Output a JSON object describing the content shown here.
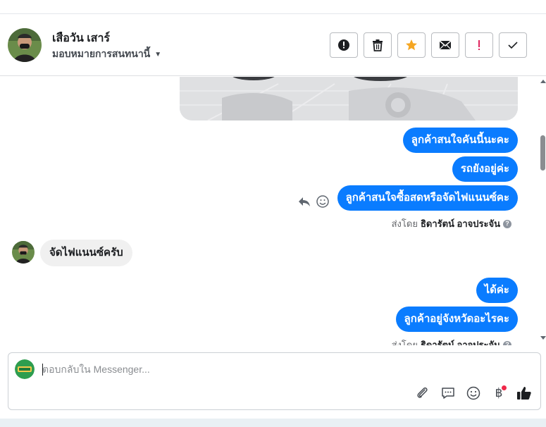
{
  "header": {
    "contact_name": "เสือวัน เสาร์",
    "assign_label": "มอบหมายการสนทนานี้",
    "actions": [
      {
        "name": "report-spam-button",
        "icon": "alert-circle-icon"
      },
      {
        "name": "delete-button",
        "icon": "trash-icon"
      },
      {
        "name": "star-button",
        "icon": "star-icon",
        "color": "#f5a623"
      },
      {
        "name": "mark-unread-button",
        "icon": "envelope-icon"
      },
      {
        "name": "follow-up-button",
        "icon": "exclamation-icon",
        "color": "#e0245e"
      },
      {
        "name": "mark-done-button",
        "icon": "checkmark-icon"
      }
    ]
  },
  "messages": {
    "out_1": "ลูกค้าสนใจคันนี้นะคะ",
    "out_2": "รถยังอยู่ค่ะ",
    "out_3": "ลูกค้าสนใจซื้อสดหรือจัดไฟแนนซ์คะ",
    "sent_by_prefix": "ส่งโดย",
    "sent_by_name": "ธิดารัตน์ อาจประจัน",
    "in_1": "จัดไฟแนนซ์ครับ",
    "out_4": "ได้ค่ะ",
    "out_5": "ลูกค้าอยู่จังหวัดอะไรคะ",
    "sent_by_prefix_2": "ส่งโดย",
    "sent_by_name_2": "ธิดารัตน์ อาจประจัน"
  },
  "composer": {
    "placeholder": "ตอบกลับใน Messenger...",
    "tools": [
      "attachment-icon",
      "saved-replies-icon",
      "emoji-icon",
      "payment-baht-icon",
      "like-icon"
    ]
  },
  "colors": {
    "accent": "#0a7cff",
    "incoming_bubble": "#f0f0f0",
    "star": "#f5a623",
    "follow_up": "#e0245e",
    "notification_dot": "#f02849"
  }
}
